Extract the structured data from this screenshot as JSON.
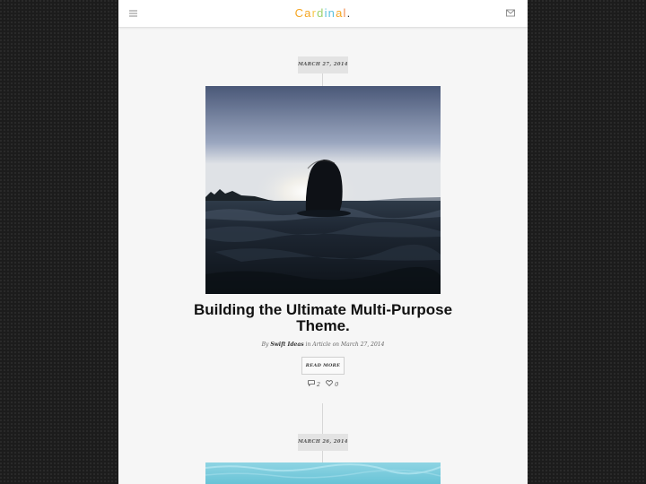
{
  "header": {
    "logo_letters": [
      {
        "char": "C",
        "color": "#f5a623"
      },
      {
        "char": "a",
        "color": "#f5a623"
      },
      {
        "char": "r",
        "color": "#f7c84a"
      },
      {
        "char": "d",
        "color": "#9bd06b"
      },
      {
        "char": "i",
        "color": "#5bc0de"
      },
      {
        "char": "n",
        "color": "#5bc0de"
      },
      {
        "char": "a",
        "color": "#f5a623"
      },
      {
        "char": "l",
        "color": "#f08a4b"
      },
      {
        "char": ".",
        "color": "#333333"
      }
    ],
    "menu_icon": "hamburger-icon",
    "mail_icon": "envelope-icon"
  },
  "posts": [
    {
      "date": "MARCH 27, 2014",
      "title": "Building the Ultimate Multi-Purpose Theme.",
      "meta": {
        "by": "By",
        "author": "Swift Ideas",
        "in": "in",
        "category": "Article",
        "on": "on",
        "date": "March 27, 2014"
      },
      "read_more": "READ MORE",
      "comments": "2",
      "likes": "0"
    },
    {
      "date": "MARCH 26, 2014"
    }
  ],
  "colors": {
    "page_bg": "#f6f6f6",
    "outer_bg": "#1c1c1c"
  }
}
